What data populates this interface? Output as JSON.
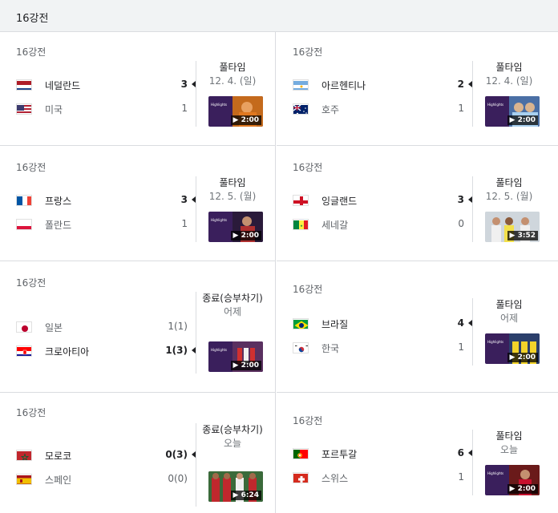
{
  "header": {
    "title": "16강전"
  },
  "matches": [
    {
      "round": "16강전",
      "status": "풀타임",
      "date": "12. 4. (일)",
      "duration": "2:00",
      "team1": {
        "name": "네덜란드",
        "score": "3",
        "winner": true
      },
      "team2": {
        "name": "미국",
        "score": "1",
        "winner": false
      }
    },
    {
      "round": "16강전",
      "status": "풀타임",
      "date": "12. 4. (일)",
      "duration": "2:00",
      "team1": {
        "name": "아르헨티나",
        "score": "2",
        "winner": true
      },
      "team2": {
        "name": "호주",
        "score": "1",
        "winner": false
      }
    },
    {
      "round": "16강전",
      "status": "풀타임",
      "date": "12. 5. (월)",
      "duration": "2:00",
      "team1": {
        "name": "프랑스",
        "score": "3",
        "winner": true
      },
      "team2": {
        "name": "폴란드",
        "score": "1",
        "winner": false
      }
    },
    {
      "round": "16강전",
      "status": "풀타임",
      "date": "12. 5. (월)",
      "duration": "3:52",
      "team1": {
        "name": "잉글랜드",
        "score": "3",
        "winner": true
      },
      "team2": {
        "name": "세네갈",
        "score": "0",
        "winner": false
      }
    },
    {
      "round": "16강전",
      "status": "종료(승부차기)",
      "date": "어제",
      "duration": "2:00",
      "team1": {
        "name": "일본",
        "score": "1(1)",
        "winner": false
      },
      "team2": {
        "name": "크로아티아",
        "score": "1(3)",
        "winner": true
      }
    },
    {
      "round": "16강전",
      "status": "풀타임",
      "date": "어제",
      "duration": "2:00",
      "team1": {
        "name": "브라질",
        "score": "4",
        "winner": true
      },
      "team2": {
        "name": "한국",
        "score": "1",
        "winner": false
      }
    },
    {
      "round": "16강전",
      "status": "종료(승부차기)",
      "date": "오늘",
      "duration": "6:24",
      "team1": {
        "name": "모로코",
        "score": "0(3)",
        "winner": true
      },
      "team2": {
        "name": "스페인",
        "score": "0(0)",
        "winner": false
      }
    },
    {
      "round": "16강전",
      "status": "풀타임",
      "date": "오늘",
      "duration": "2:00",
      "team1": {
        "name": "포르투갈",
        "score": "6",
        "winner": true
      },
      "team2": {
        "name": "스위스",
        "score": "1",
        "winner": false
      }
    }
  ],
  "thumb_label": "Highlights",
  "colors": {
    "border": "#dadce0",
    "header_bg": "#f1f3f4",
    "thumb_bg": "#3a1f5c"
  }
}
